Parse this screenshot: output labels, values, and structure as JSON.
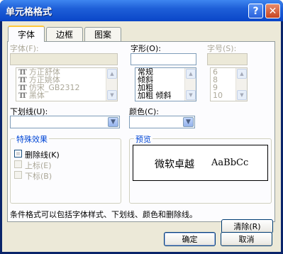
{
  "window": {
    "title": "单元格格式",
    "help_glyph": "?",
    "close_glyph": "✕"
  },
  "tabs": [
    {
      "label": "字体",
      "active": true
    },
    {
      "label": "边框",
      "active": false
    },
    {
      "label": "图案",
      "active": false
    }
  ],
  "font": {
    "label": "字体(F):",
    "value": "",
    "items": [
      "方正舒体",
      "方正姚体",
      "仿宋_GB2312",
      "黑体"
    ],
    "icon_glyph": "T"
  },
  "style": {
    "label": "字形(O):",
    "value": "",
    "items": [
      "常规",
      "倾斜",
      "加粗",
      "加粗 倾斜"
    ]
  },
  "size": {
    "label": "字号(S):",
    "value": "",
    "items": [
      "6",
      "8",
      "9",
      "10"
    ]
  },
  "underline": {
    "label": "下划线(U):",
    "value": ""
  },
  "color": {
    "label": "颜色(C):",
    "value": ""
  },
  "effects": {
    "title": "特殊效果",
    "items": [
      {
        "label": "删除线(K)",
        "enabled": true
      },
      {
        "label": "上标(E)",
        "enabled": false
      },
      {
        "label": "下标(B)",
        "enabled": false
      }
    ]
  },
  "preview": {
    "title": "预览",
    "sample_cn": "微软卓越",
    "sample_en": "AaBbCc"
  },
  "info_text": "条件格式可以包括字体样式、下划线、颜色和删除线。",
  "buttons": {
    "clear": "清除(R)",
    "ok": "确定",
    "cancel": "取消"
  },
  "scroll": {
    "up": "▲",
    "down": "▼",
    "drop": "▼"
  }
}
